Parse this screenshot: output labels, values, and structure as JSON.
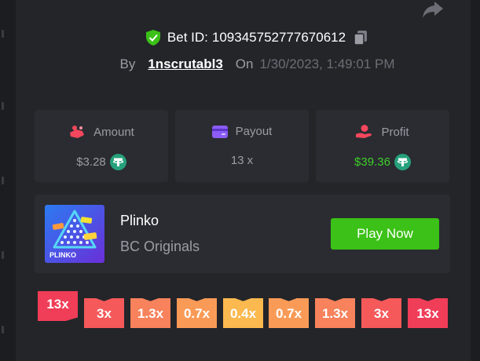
{
  "bet": {
    "label": "Bet ID:",
    "id": "109345752777670612"
  },
  "meta": {
    "by_label": "By",
    "username": "1nscrutabl3",
    "on_label": "On",
    "date": "1/30/2023, 1:49:01 PM"
  },
  "stats": {
    "amount": {
      "label": "Amount",
      "value": "$3.28"
    },
    "payout": {
      "label": "Payout",
      "value": "13 x"
    },
    "profit": {
      "label": "Profit",
      "value": "$39.36"
    }
  },
  "game": {
    "name": "Plinko",
    "provider": "BC Originals",
    "play_label": "Play Now",
    "thumb_text": "PLINKO"
  },
  "multipliers": [
    {
      "label": "13x",
      "color": "#f03d58",
      "active": true
    },
    {
      "label": "3x",
      "color": "#f5595a"
    },
    {
      "label": "1.3x",
      "color": "#f7825c"
    },
    {
      "label": "0.7x",
      "color": "#f99b57"
    },
    {
      "label": "0.4x",
      "color": "#fbb94f"
    },
    {
      "label": "0.7x",
      "color": "#f99b57"
    },
    {
      "label": "1.3x",
      "color": "#f7825c"
    },
    {
      "label": "3x",
      "color": "#f5595a"
    },
    {
      "label": "13x",
      "color": "#f03d58"
    }
  ],
  "colors": {
    "accent_green": "#3bc117",
    "profit_green": "#3fce29",
    "tether": "#26a17b"
  },
  "icons": [
    "share-icon",
    "shield-check-icon",
    "copy-icon",
    "coins-icon",
    "wallet-icon",
    "hand-coin-icon",
    "tether-icon"
  ]
}
